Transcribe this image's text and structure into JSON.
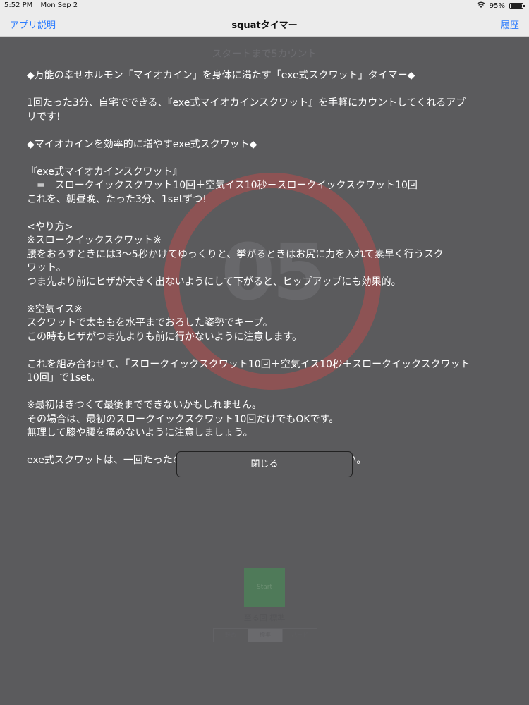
{
  "status_bar": {
    "time": "5:52 PM",
    "date": "Mon Sep 2",
    "battery": "95%",
    "icons": [
      "wifi-icon",
      "battery-icon"
    ]
  },
  "nav": {
    "left_label": "アプリ説明",
    "title": "squatタイマー",
    "right_label": "履歴"
  },
  "background": {
    "caption": "スタートまで5カウント",
    "count": "05",
    "start_label": "Start",
    "small_label": "至る回 標準",
    "segments": [
      "軽め",
      "標準",
      "ハード"
    ],
    "selected_segment": 1,
    "ring_color": "#8d5354"
  },
  "description": {
    "lines": [
      "◆万能の幸せホルモン「マイオカイン」を身体に満たす「exe式スクワット」タイマー◆",
      "",
      "1回たった3分、自宅でできる、『exe式マイオカインスクワット』を手軽にカウントしてくれるアプ",
      "リです!",
      "",
      "◆マイオカインを効率的に増やすexe式スクワット◆",
      "",
      "『exe式マイオカインスクワット』",
      "　=　スロークイックスクワット10回＋空気イス10秒＋スロークイックスクワット10回",
      "これを、朝昼晩、たった3分、1setずつ!",
      "",
      "<やり方>",
      "※スロークイックスクワット※",
      "腰をおろすときには3〜5秒かけてゆっくりと、挙がるときはお尻に力を入れて素早く行うスク",
      "ワット。",
      "つま先より前にヒザが大きく出ないようにして下がると、ヒップアップにも効果的。",
      "",
      "※空気イス※",
      "スクワットで太ももを水平までおろした姿勢でキープ。",
      "この時もヒザがつま先よりも前に行かないように注意します。",
      "",
      "これを組み合わせて、「スロークイックスクワット10回＋空気イス10秒＋スロークイックスクワット",
      "10回」で1set。",
      "",
      "※最初はきつくて最後までできないかもしれません。",
      "その場合は、最初のスロークイックスクワット10回だけでもOKです。",
      "無理して膝や腰を痛めないように注意しましょう。",
      "",
      "exe式スクワットは、一回たったの3分。まずは気楽に続けてみてください。"
    ]
  },
  "close_button": {
    "label": "閉じる"
  },
  "colors": {
    "accent": "#2a7bff",
    "overlay": "#5b5b5d",
    "text": "#ffffff"
  }
}
